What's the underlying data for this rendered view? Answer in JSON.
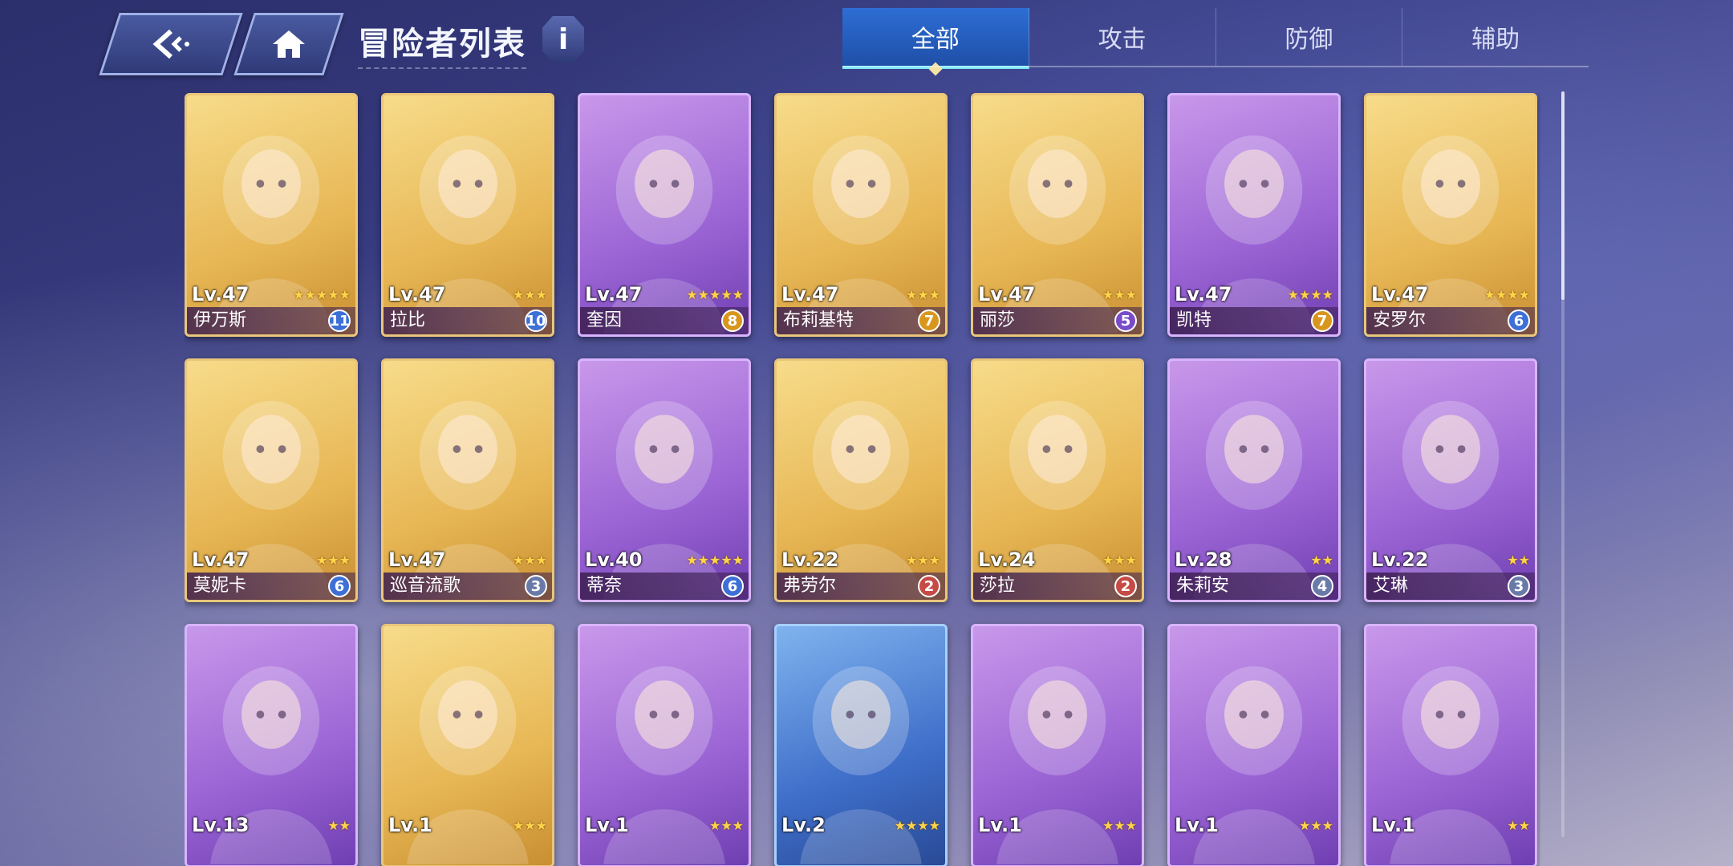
{
  "header": {
    "back_icon": "back-arrow-icon",
    "home_icon": "home-icon",
    "title": "冒险者列表",
    "info_label": "i"
  },
  "tabs": [
    {
      "label": "全部",
      "active": true
    },
    {
      "label": "攻击",
      "active": false
    },
    {
      "label": "防御",
      "active": false
    },
    {
      "label": "辅助",
      "active": false
    }
  ],
  "cards": [
    {
      "level": "Lv.47",
      "name": "伊万斯",
      "rank": "11",
      "stars": 5,
      "frame": "gold",
      "rank_color": "blue"
    },
    {
      "level": "Lv.47",
      "name": "拉比",
      "rank": "10",
      "stars": 3,
      "frame": "gold",
      "rank_color": "blue"
    },
    {
      "level": "Lv.47",
      "name": "奎因",
      "rank": "8",
      "stars": 5,
      "frame": "purple",
      "rank_color": "gold"
    },
    {
      "level": "Lv.47",
      "name": "布莉基特",
      "rank": "7",
      "stars": 3,
      "frame": "gold",
      "rank_color": "gold"
    },
    {
      "level": "Lv.47",
      "name": "丽莎",
      "rank": "5",
      "stars": 3,
      "frame": "gold",
      "rank_color": "purple"
    },
    {
      "level": "Lv.47",
      "name": "凯特",
      "rank": "7",
      "stars": 4,
      "frame": "purple",
      "rank_color": "gold"
    },
    {
      "level": "Lv.47",
      "name": "安罗尔",
      "rank": "6",
      "stars": 4,
      "frame": "gold",
      "rank_color": "blue"
    },
    {
      "level": "Lv.47",
      "name": "莫妮卡",
      "rank": "6",
      "stars": 3,
      "frame": "gold",
      "rank_color": "blue"
    },
    {
      "level": "Lv.47",
      "name": "巡音流歌",
      "rank": "3",
      "stars": 3,
      "frame": "gold",
      "rank_color": "gray"
    },
    {
      "level": "Lv.40",
      "name": "蒂奈",
      "rank": "6",
      "stars": 5,
      "frame": "purple",
      "rank_color": "blue"
    },
    {
      "level": "Lv.22",
      "name": "弗劳尔",
      "rank": "2",
      "stars": 3,
      "frame": "gold",
      "rank_color": "red"
    },
    {
      "level": "Lv.24",
      "name": "莎拉",
      "rank": "2",
      "stars": 3,
      "frame": "gold",
      "rank_color": "red"
    },
    {
      "level": "Lv.28",
      "name": "朱莉安",
      "rank": "4",
      "stars": 2,
      "frame": "purple",
      "rank_color": "gray"
    },
    {
      "level": "Lv.22",
      "name": "艾琳",
      "rank": "3",
      "stars": 2,
      "frame": "purple",
      "rank_color": "gray"
    },
    {
      "level": "Lv.13",
      "name": "",
      "rank": "",
      "stars": 2,
      "frame": "purple",
      "rank_color": "gray"
    },
    {
      "level": "Lv.1",
      "name": "",
      "rank": "",
      "stars": 3,
      "frame": "gold",
      "rank_color": "gray"
    },
    {
      "level": "Lv.1",
      "name": "",
      "rank": "",
      "stars": 3,
      "frame": "purple",
      "rank_color": "gray"
    },
    {
      "level": "Lv.2",
      "name": "",
      "rank": "",
      "stars": 4,
      "frame": "blue",
      "rank_color": "gray"
    },
    {
      "level": "Lv.1",
      "name": "",
      "rank": "",
      "stars": 3,
      "frame": "purple",
      "rank_color": "gray"
    },
    {
      "level": "Lv.1",
      "name": "",
      "rank": "",
      "stars": 3,
      "frame": "purple",
      "rank_color": "gray"
    },
    {
      "level": "Lv.1",
      "name": "",
      "rank": "",
      "stars": 2,
      "frame": "purple",
      "rank_color": "gray"
    }
  ],
  "colors": {
    "accent_tab": "#2d6ed4",
    "gold_frame": "#e9c67a",
    "purple_frame": "#9a63d4",
    "star": "#ffd44a"
  }
}
